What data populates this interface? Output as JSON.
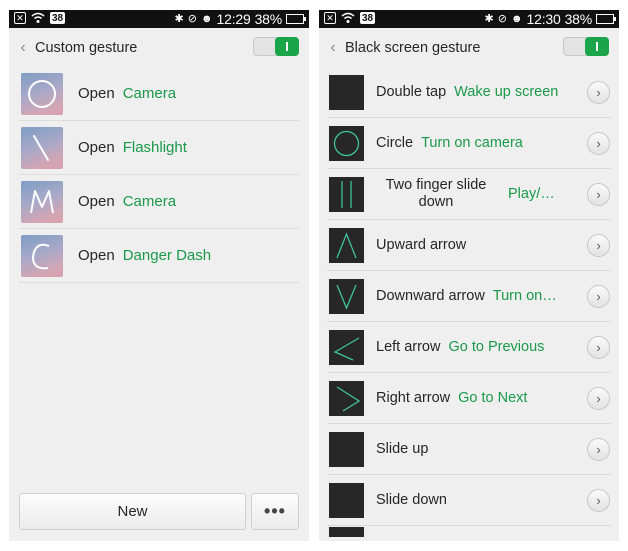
{
  "statusbar_left": {
    "time": "12:29",
    "battery": "38%",
    "notif_count": "38",
    "battery_level": 0.38
  },
  "statusbar_right": {
    "time": "12:30",
    "battery": "38%",
    "notif_count": "38",
    "battery_level": 0.38
  },
  "left_screen": {
    "title": "Custom gesture",
    "toggle_on": true,
    "gestures": [
      {
        "verb": "Open",
        "target": "Camera",
        "shape": "circle"
      },
      {
        "verb": "Open",
        "target": "Flashlight",
        "shape": "backslash"
      },
      {
        "verb": "Open",
        "target": "Camera",
        "shape": "letter-m"
      },
      {
        "verb": "Open",
        "target": "Danger Dash",
        "shape": "letter-c"
      }
    ],
    "new_button": "New",
    "more_button": "•••"
  },
  "right_screen": {
    "title": "Black screen gesture",
    "toggle_on": true,
    "gestures": [
      {
        "label": "Double tap",
        "action": "Wake up screen",
        "shape": "none"
      },
      {
        "label": "Circle",
        "action": "Turn on camera",
        "shape": "circle"
      },
      {
        "label": "Two finger slide down",
        "action": "Play/…",
        "shape": "two-lines"
      },
      {
        "label": "Upward arrow",
        "action": "",
        "shape": "up-arrow"
      },
      {
        "label": "Downward arrow",
        "action": "Turn on…",
        "shape": "down-arrow"
      },
      {
        "label": "Left arrow",
        "action": "Go to Previous",
        "shape": "left-arrow"
      },
      {
        "label": "Right arrow",
        "action": "Go to Next",
        "shape": "right-arrow"
      },
      {
        "label": "Slide up",
        "action": "",
        "shape": "none"
      },
      {
        "label": "Slide down",
        "action": "",
        "shape": "none"
      }
    ]
  },
  "colors": {
    "accent_green": "#1a9a49",
    "toggle_green": "#1aa54b",
    "statusbar": "#111111",
    "gesture_stroke": "#3fc49a"
  }
}
